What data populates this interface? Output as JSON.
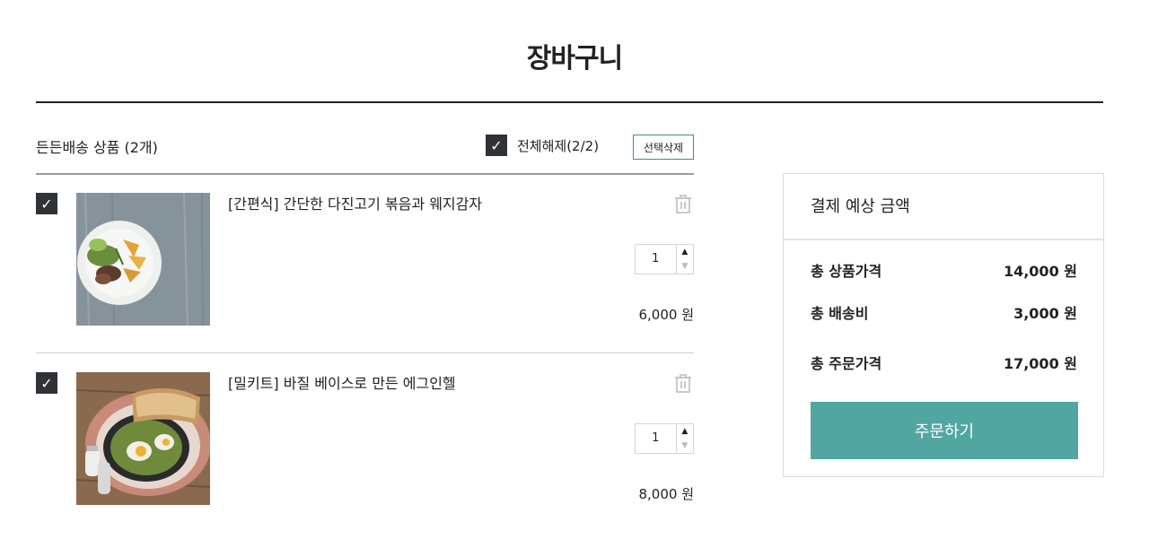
{
  "page": {
    "title": "장바구니"
  },
  "cart": {
    "section_label": "든든배송 상품 (2개)",
    "select_all_label": "전체해제(2/2)",
    "delete_selected_label": "선택삭제",
    "items": [
      {
        "name": "[간편식] 간단한 다진고기 볶음과 웨지감자",
        "quantity": "1",
        "price": "6,000 원",
        "checked": true
      },
      {
        "name": "[밀키트] 바질 베이스로 만든 에그인헬",
        "quantity": "1",
        "price": "8,000 원",
        "checked": true
      }
    ]
  },
  "summary": {
    "title": "결제 예상 금액",
    "rows": [
      {
        "label": "총 상품가격",
        "value": "14,000 원"
      },
      {
        "label": "총 배송비",
        "value": "3,000 원"
      },
      {
        "label": "총 주문가격",
        "value": "17,000 원"
      }
    ],
    "order_button_label": "주문하기"
  },
  "icons": {
    "checkbox": "checkmark-icon",
    "trash": "trash-icon",
    "qty_up": "triangle-up-icon",
    "qty_down": "triangle-down-icon"
  },
  "colors": {
    "accent": "#52a6a0",
    "checkbox_fill": "#2f3338",
    "delete_border": "#3f8f8a"
  }
}
